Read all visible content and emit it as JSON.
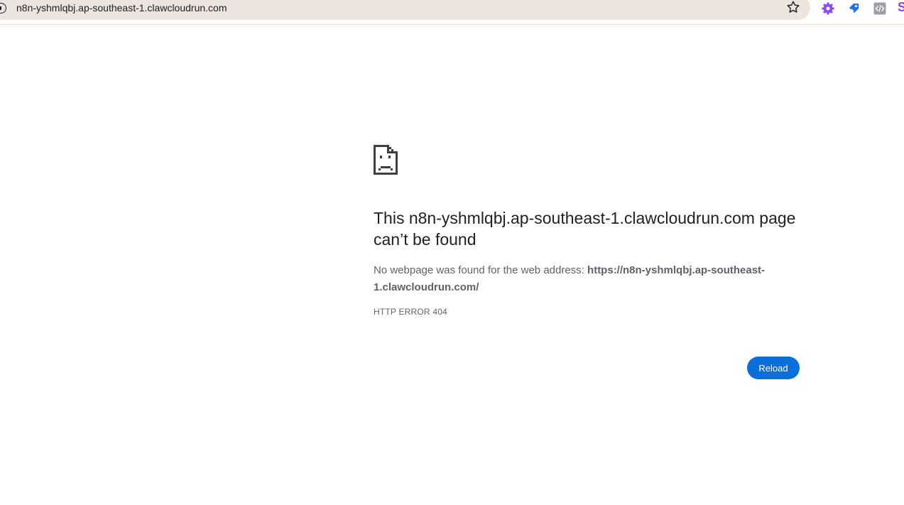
{
  "browser": {
    "url": "n8n-yshmlqbj.ap-southeast-1.clawcloudrun.com",
    "icons": [
      "info-icon",
      "star-icon",
      "gear-extension-icon",
      "tag-extension-icon",
      "code-extension-icon"
    ],
    "extension_s_label": "S"
  },
  "error_page": {
    "icon": "sad-page-icon",
    "title": "This n8n-yshmlqbj.ap-southeast-1.clawcloudrun.com page can’t be found",
    "description_prefix": "No webpage was found for the web address: ",
    "description_url": "https://n8n-yshmlqbj.ap-southeast-1.clawcloudrun.com/",
    "error_code": "HTTP ERROR 404",
    "reload_label": "Reload",
    "accent_color": "#0b6fdb"
  }
}
